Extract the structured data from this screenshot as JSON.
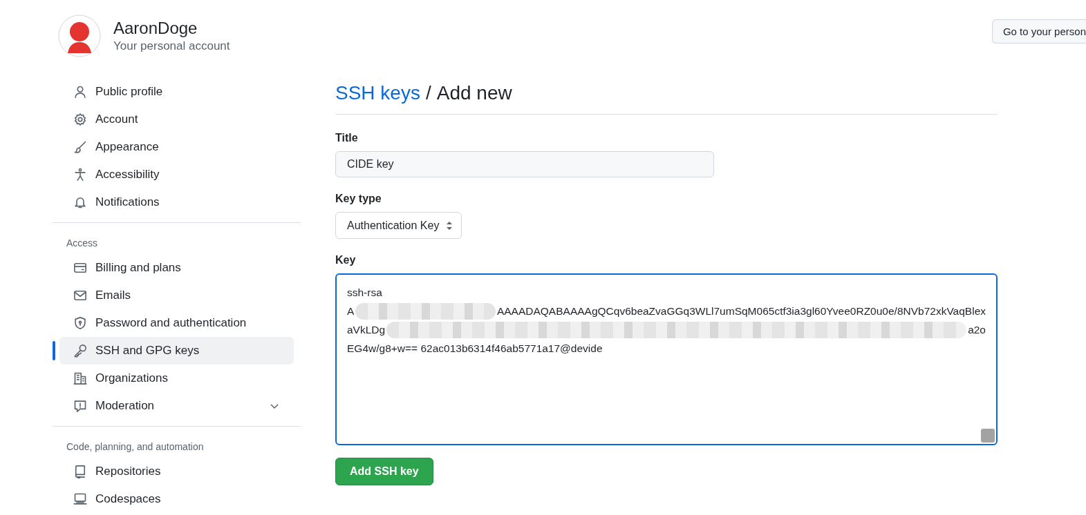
{
  "account": {
    "name": "AaronDoge",
    "subtitle": "Your personal account",
    "action": "Go to your person"
  },
  "sidebar": {
    "groups": [
      {
        "items": [
          {
            "label": "Public profile",
            "selected": false
          },
          {
            "label": "Account",
            "selected": false
          },
          {
            "label": "Appearance",
            "selected": false
          },
          {
            "label": "Accessibility",
            "selected": false
          },
          {
            "label": "Notifications",
            "selected": false
          }
        ]
      },
      {
        "heading": "Access",
        "items": [
          {
            "label": "Billing and plans",
            "selected": false
          },
          {
            "label": "Emails",
            "selected": false
          },
          {
            "label": "Password and authentication",
            "selected": false
          },
          {
            "label": "SSH and GPG keys",
            "selected": true
          },
          {
            "label": "Organizations",
            "selected": false
          },
          {
            "label": "Moderation",
            "selected": false,
            "expanded": false
          }
        ]
      },
      {
        "heading": "Code, planning, and automation",
        "items": [
          {
            "label": "Repositories",
            "selected": false
          },
          {
            "label": "Codespaces",
            "selected": false
          }
        ]
      }
    ]
  },
  "page": {
    "breadcrumb_link": "SSH keys",
    "separator": "/",
    "title": "Add new"
  },
  "form": {
    "title_label": "Title",
    "title_value": "CIDE key",
    "type_label": "Key type",
    "type_value": "Authentication Key",
    "key_label": "Key",
    "key_lines": [
      [
        "ssh-rsa"
      ],
      [
        "A",
        "AAAADAQABAAAAgQCqv6beaZvaGGq3WLl7umSqM065ctf3ia3gl60Yvee0RZ0u0e/8NVb72xkVaqBlex"
      ],
      [
        "aVkLDg",
        "a2o"
      ],
      [
        "EG4w/g8+w== 62ac013b6314f46ab5771a17@devide"
      ]
    ],
    "submit": "Add SSH key"
  }
}
